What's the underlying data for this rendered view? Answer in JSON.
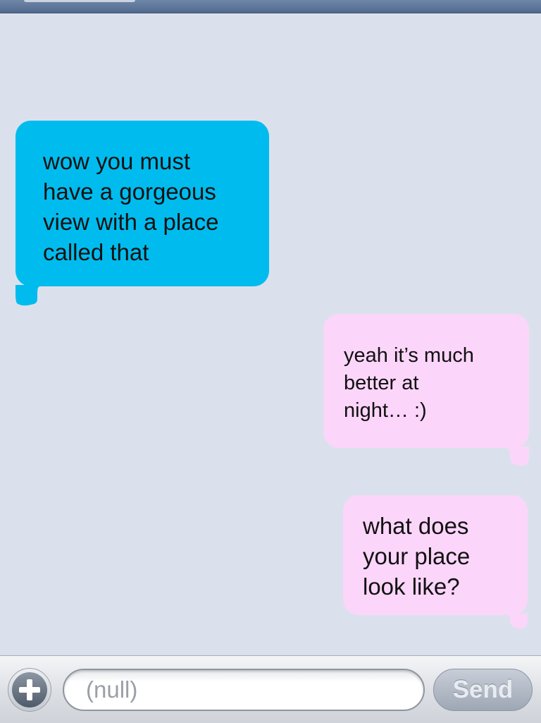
{
  "messages": [
    {
      "direction": "received",
      "text": "wow you must\nhave a gorgeous\nview with a place\ncalled that"
    },
    {
      "direction": "sent",
      "text": "yeah it’s much\nbetter at\nnight… :)"
    },
    {
      "direction": "sent",
      "text": "what does\nyour place\nlook like?"
    }
  ],
  "compose": {
    "add_icon": "plus-icon",
    "input_value": "(null)",
    "send_label": "Send"
  },
  "colors": {
    "background": "#dbe1ec",
    "received_bubble": "#00bcee",
    "sent_bubble": "#fcd5fa",
    "send_button": "#a9b1be"
  }
}
